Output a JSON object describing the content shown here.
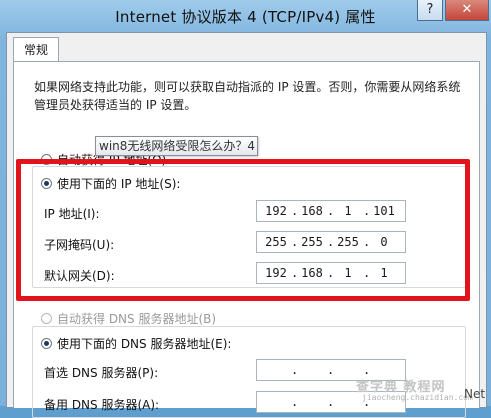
{
  "window": {
    "title": "Internet 协议版本 4 (TCP/IPv4) 属性",
    "help_label": "?",
    "close_label": "✕"
  },
  "tabs": [
    {
      "label": "常规"
    }
  ],
  "general": {
    "description": "如果网络支持此功能，则可以获取自动指派的 IP 设置。否则，你需要从网络系统管理员处获得适当的 IP 设置。",
    "ip_auto_label": "自动获得 IP 地址(O)",
    "ip_manual_label": "使用下面的 IP 地址(S):",
    "ip_manual_selected": true,
    "ip_address_label": "IP 地址(I):",
    "ip_address": [
      "192",
      "168",
      "1",
      "101"
    ],
    "subnet_label": "子网掩码(U):",
    "subnet": [
      "255",
      "255",
      "255",
      "0"
    ],
    "gateway_label": "默认网关(D):",
    "gateway": [
      "192",
      "168",
      "1",
      "1"
    ],
    "dns_auto_label": "自动获得 DNS 服务器地址(B)",
    "dns_manual_label": "使用下面的 DNS 服务器地址(E):",
    "dns_manual_selected": true,
    "preferred_dns_label": "首选 DNS 服务器(P):",
    "preferred_dns": [
      "",
      "",
      "",
      ""
    ],
    "alternate_dns_label": "备用 DNS 服务器(A):",
    "alternate_dns": [
      "",
      "",
      "",
      ""
    ]
  },
  "tooltip": {
    "text": "win8无线网络受限怎么办？4"
  },
  "watermark": {
    "main": "查字典 教程网",
    "sub": "jiaocheng.chazidian.com",
    "net": "Net"
  },
  "colors": {
    "highlight": "#e0141a",
    "close_button": "#c5453a"
  }
}
